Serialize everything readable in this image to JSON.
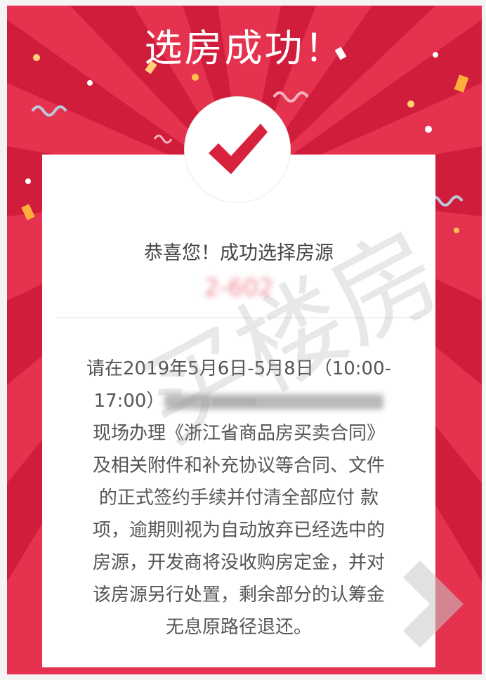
{
  "title": "选房成功！",
  "card": {
    "headline": "恭喜您！成功选择房源",
    "room_number": "2-602",
    "body_lines": [
      "请在2019年5月6日-5月8日（10:00-",
      "17:00）",
      "现场办理《浙江省商品房买卖合同》",
      "及相关附件和补充协议等合同、文件",
      "的正式签约手续并付清全部应付 款",
      "项，逾期则视为自动放弃已经选中的",
      "房源，开发商将没收购房定金，并对",
      "该房源另行处置，剩余部分的认筹金",
      "无息原路径退还。"
    ]
  },
  "watermark": "买楼房",
  "colors": {
    "background": "#e5324f",
    "rays": "#cf1d3b",
    "check": "#d8213d",
    "card": "#ffffff"
  },
  "icons": {
    "check": "check-icon",
    "confetti": "confetti-icon",
    "corner": "arrow-mark-icon"
  }
}
